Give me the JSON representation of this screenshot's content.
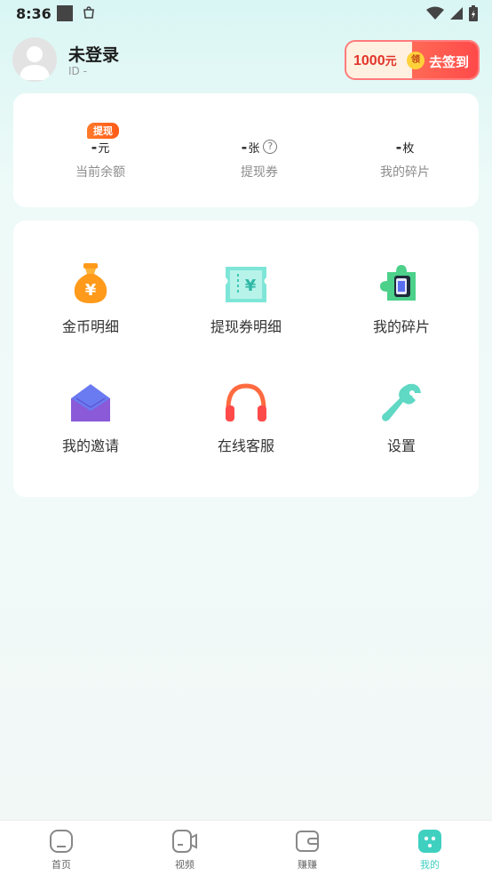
{
  "status_bar": {
    "time": "8:36"
  },
  "user": {
    "name": "未登录",
    "id_text": "ID -"
  },
  "checkin": {
    "amount": "1000",
    "amount_unit": "元",
    "badge": "领",
    "label": "去签到"
  },
  "stats": [
    {
      "value": "-",
      "unit": "元",
      "label": "当前余额",
      "tag": "提现"
    },
    {
      "value": "-",
      "unit": "张",
      "label": "提现券",
      "help": "?"
    },
    {
      "value": "-",
      "unit": "枚",
      "label": "我的碎片"
    }
  ],
  "menu": [
    {
      "label": "金币明细",
      "icon": "money-bag-icon"
    },
    {
      "label": "提现券明细",
      "icon": "coupon-icon"
    },
    {
      "label": "我的碎片",
      "icon": "puzzle-icon"
    },
    {
      "label": "我的邀请",
      "icon": "envelope-icon"
    },
    {
      "label": "在线客服",
      "icon": "headphones-icon"
    },
    {
      "label": "设置",
      "icon": "wrench-icon"
    }
  ],
  "bottom_nav": [
    {
      "label": "首页",
      "icon": "home-icon"
    },
    {
      "label": "视频",
      "icon": "video-icon"
    },
    {
      "label": "赚赚",
      "icon": "wallet-icon"
    },
    {
      "label": "我的",
      "icon": "profile-icon",
      "active": true
    }
  ],
  "colors": {
    "accent": "#3fd0c0",
    "checkin_red": "#ff4a4a",
    "tag_orange": "#ff6a20"
  }
}
